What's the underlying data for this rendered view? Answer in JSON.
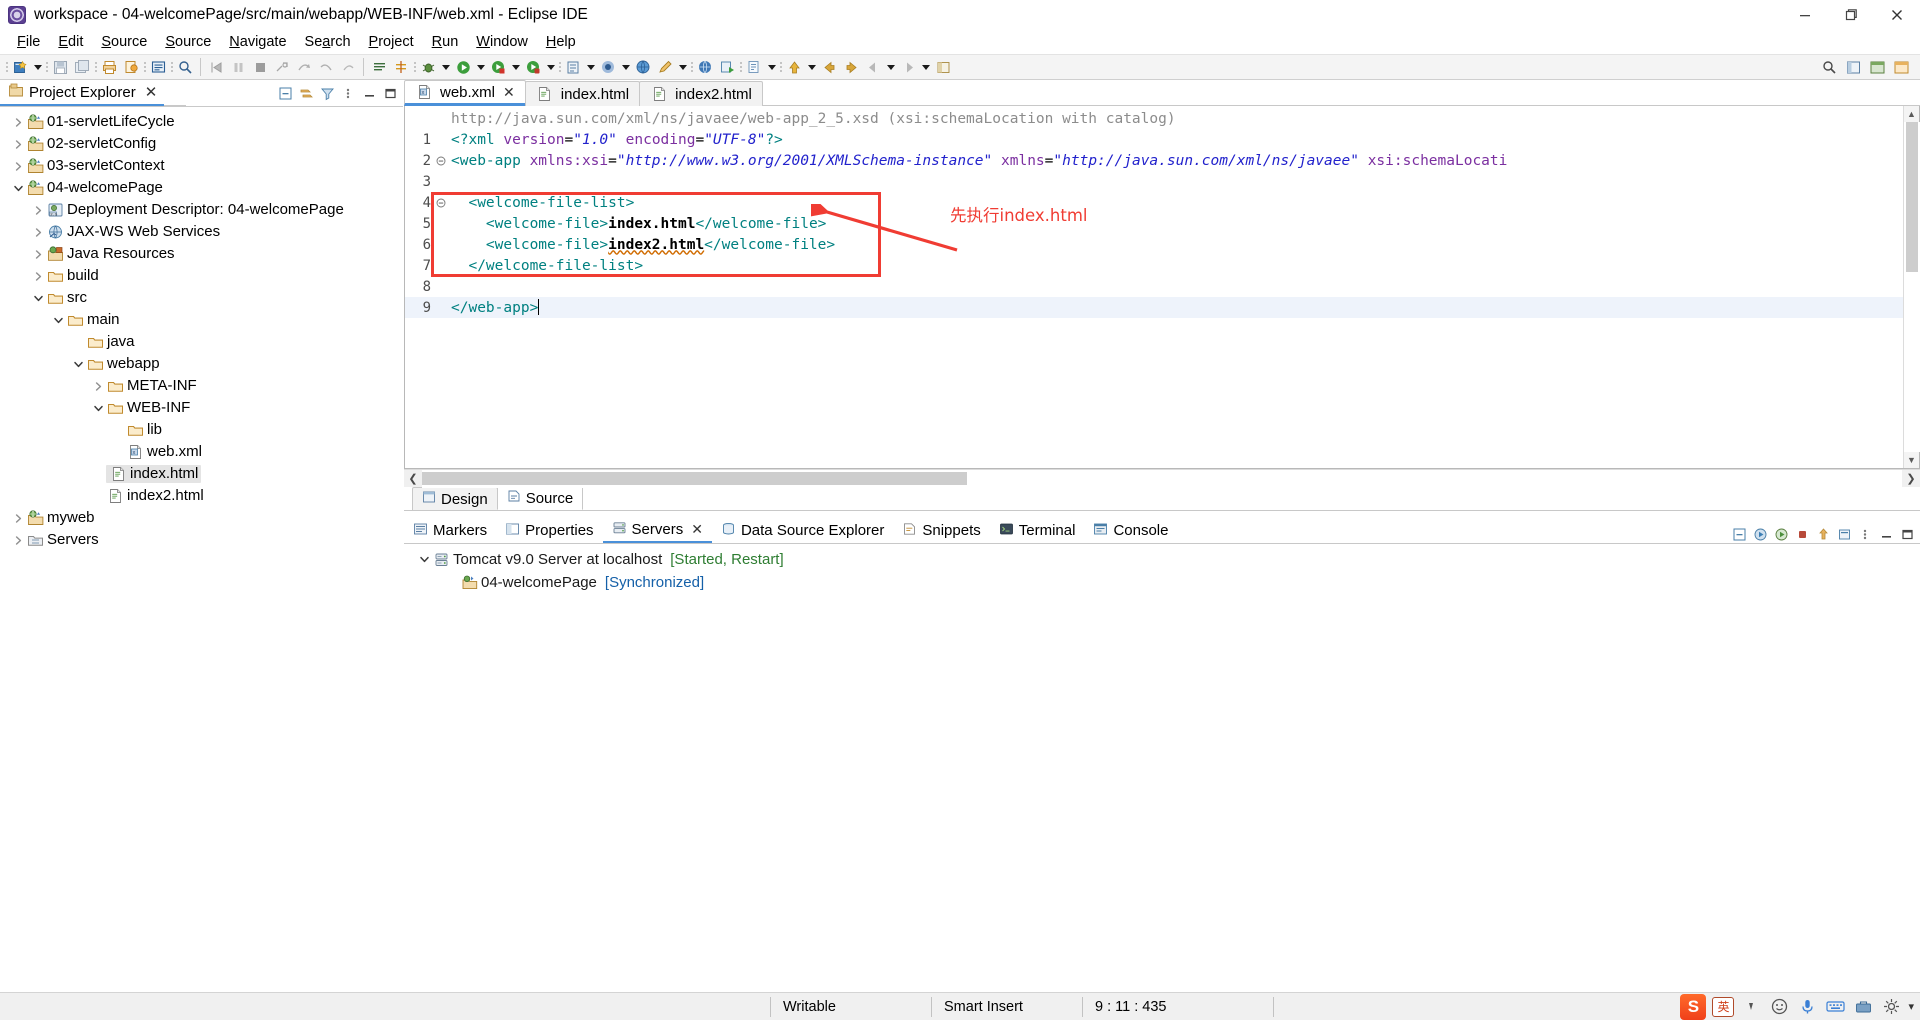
{
  "window": {
    "title": "workspace - 04-welcomePage/src/main/webapp/WEB-INF/web.xml - Eclipse IDE",
    "minimize_label": "Minimize",
    "maximize_label": "Restore",
    "close_label": "Close"
  },
  "menubar": {
    "items": [
      {
        "label": "File",
        "mnemonic": "F"
      },
      {
        "label": "Edit",
        "mnemonic": "E"
      },
      {
        "label": "Source",
        "mnemonic": "S"
      },
      {
        "label": "Source",
        "mnemonic": "S"
      },
      {
        "label": "Navigate",
        "mnemonic": "N"
      },
      {
        "label": "Search",
        "mnemonic": "a"
      },
      {
        "label": "Project",
        "mnemonic": "P"
      },
      {
        "label": "Run",
        "mnemonic": "R"
      },
      {
        "label": "Window",
        "mnemonic": "W"
      },
      {
        "label": "Help",
        "mnemonic": "H"
      }
    ]
  },
  "toolbar": {
    "icons": [
      "new-wizard-icon",
      "save-icon",
      "save-all-icon",
      "print-icon",
      "build-icon",
      "new-editor-icon",
      "quick-access-icon",
      "step-into-icon",
      "pause-icon",
      "terminate-icon",
      "disconnect-icon",
      "step-over-icon",
      "step-return-icon",
      "resume-icon",
      "toggle-breakpoint-icon",
      "skip-breakpoints-icon",
      "debug-icon",
      "run-icon",
      "run-external-icon",
      "run-server-icon",
      "coverage-icon",
      "open-type-icon",
      "search-icon",
      "browser-icon",
      "edit-icon",
      "globe-icon",
      "java-perspective-icon",
      "validate-icon",
      "back-icon",
      "forward-icon",
      "previous-annotation-icon",
      "next-annotation-icon",
      "last-edit-icon",
      "open-perspective-icon"
    ],
    "right_icons": [
      "search-icon",
      "open-perspective-icon",
      "java-ee-perspective-icon",
      "web-perspective-icon"
    ]
  },
  "project_explorer": {
    "tab_label": "Project Explorer",
    "tools": [
      "collapse-all-icon",
      "link-with-editor-icon",
      "view-menu-icon",
      "view-filter-icon",
      "minimize-icon",
      "maximize-icon"
    ],
    "tree": [
      {
        "label": "01-servletLifeCycle",
        "indent": 0,
        "arrow": "collapsed",
        "icon": "web-project-icon",
        "selected": false
      },
      {
        "label": "02-servletConfig",
        "indent": 0,
        "arrow": "collapsed",
        "icon": "web-project-icon",
        "selected": false
      },
      {
        "label": "03-servletContext",
        "indent": 0,
        "arrow": "collapsed",
        "icon": "web-project-icon",
        "selected": false
      },
      {
        "label": "04-welcomePage",
        "indent": 0,
        "arrow": "expanded",
        "icon": "web-project-icon",
        "selected": false
      },
      {
        "label": "Deployment Descriptor: 04-welcomePage",
        "indent": 1,
        "arrow": "collapsed",
        "icon": "deployment-descriptor-icon",
        "selected": false
      },
      {
        "label": "JAX-WS Web Services",
        "indent": 1,
        "arrow": "collapsed",
        "icon": "jaxws-icon",
        "selected": false
      },
      {
        "label": "Java Resources",
        "indent": 1,
        "arrow": "collapsed",
        "icon": "java-resources-icon",
        "selected": false
      },
      {
        "label": "build",
        "indent": 1,
        "arrow": "collapsed",
        "icon": "folder-icon",
        "selected": false
      },
      {
        "label": "src",
        "indent": 1,
        "arrow": "expanded",
        "icon": "folder-icon",
        "selected": false
      },
      {
        "label": "main",
        "indent": 2,
        "arrow": "expanded",
        "icon": "folder-icon",
        "selected": false
      },
      {
        "label": "java",
        "indent": 3,
        "arrow": "none",
        "icon": "folder-icon",
        "selected": false
      },
      {
        "label": "webapp",
        "indent": 3,
        "arrow": "expanded",
        "icon": "folder-icon",
        "selected": false
      },
      {
        "label": "META-INF",
        "indent": 4,
        "arrow": "collapsed",
        "icon": "folder-icon",
        "selected": false
      },
      {
        "label": "WEB-INF",
        "indent": 4,
        "arrow": "expanded",
        "icon": "folder-icon",
        "selected": false
      },
      {
        "label": "lib",
        "indent": 5,
        "arrow": "none",
        "icon": "folder-icon",
        "selected": false
      },
      {
        "label": "web.xml",
        "indent": 5,
        "arrow": "none",
        "icon": "xml-file-icon",
        "selected": false
      },
      {
        "label": "index.html",
        "indent": 4,
        "arrow": "none",
        "icon": "html-file-icon",
        "selected": true
      },
      {
        "label": "index2.html",
        "indent": 4,
        "arrow": "none",
        "icon": "html-file-icon",
        "selected": false
      },
      {
        "label": "myweb",
        "indent": 0,
        "arrow": "collapsed",
        "icon": "web-project-icon",
        "selected": false
      },
      {
        "label": "Servers",
        "indent": 0,
        "arrow": "collapsed",
        "icon": "servers-folder-icon",
        "selected": false
      }
    ]
  },
  "editor": {
    "tabs": [
      {
        "label": "web.xml",
        "icon": "xml-file-icon",
        "active": true,
        "closable": true
      },
      {
        "label": "index.html",
        "icon": "html-file-icon",
        "active": false,
        "closable": false
      },
      {
        "label": "index2.html",
        "icon": "html-file-icon",
        "active": false,
        "closable": false
      }
    ],
    "hover_hint": "http://java.sun.com/xml/ns/javaee/web-app_2_5.xsd (xsi:schemaLocation with catalog)",
    "lines": [
      {
        "no": "1",
        "fold": "",
        "segments": [
          {
            "t": "<?xml ",
            "c": "s-pi"
          },
          {
            "t": "version",
            "c": "s-attr"
          },
          {
            "t": "=",
            "c": "s-eq"
          },
          {
            "t": "\"1.0\"",
            "c": "s-val"
          },
          {
            "t": " ",
            "c": "s-eq"
          },
          {
            "t": "encoding",
            "c": "s-attr"
          },
          {
            "t": "=",
            "c": "s-eq"
          },
          {
            "t": "\"UTF-8\"",
            "c": "s-val"
          },
          {
            "t": "?>",
            "c": "s-pi"
          }
        ]
      },
      {
        "no": "2",
        "fold": "minus",
        "segments": [
          {
            "t": "<web-app ",
            "c": "s-tag"
          },
          {
            "t": "xmlns:xsi",
            "c": "s-attr"
          },
          {
            "t": "=",
            "c": "s-eq"
          },
          {
            "t": "\"http://www.w3.org/2001/XMLSchema-instance\"",
            "c": "s-val"
          },
          {
            "t": " ",
            "c": "s-eq"
          },
          {
            "t": "xmlns",
            "c": "s-attr"
          },
          {
            "t": "=",
            "c": "s-eq"
          },
          {
            "t": "\"http://java.sun.com/xml/ns/javaee\"",
            "c": "s-val"
          },
          {
            "t": " ",
            "c": "s-eq"
          },
          {
            "t": "xsi:schemaLocati",
            "c": "s-attr"
          }
        ]
      },
      {
        "no": "3",
        "fold": "",
        "segments": []
      },
      {
        "no": "4",
        "fold": "minus",
        "segments": [
          {
            "t": "  <welcome-file-list>",
            "c": "s-tag"
          }
        ]
      },
      {
        "no": "5",
        "fold": "",
        "segments": [
          {
            "t": "    <welcome-file>",
            "c": "s-tag"
          },
          {
            "t": "index.html",
            "c": "s-txt"
          },
          {
            "t": "</welcome-file>",
            "c": "s-tag"
          }
        ]
      },
      {
        "no": "6",
        "fold": "",
        "segments": [
          {
            "t": "    <welcome-file>",
            "c": "s-tag"
          },
          {
            "t": "index2.html",
            "c": "s-txt squiggle"
          },
          {
            "t": "</welcome-file>",
            "c": "s-tag"
          }
        ]
      },
      {
        "no": "7",
        "fold": "",
        "segments": [
          {
            "t": "  </welcome-file-list>",
            "c": "s-tag"
          }
        ]
      },
      {
        "no": "8",
        "fold": "",
        "segments": []
      },
      {
        "no": "9",
        "fold": "",
        "highlight": true,
        "caret": true,
        "segments": [
          {
            "t": "</web-app>",
            "c": "s-tag"
          }
        ]
      }
    ],
    "annotation": {
      "text": "先执行index.html",
      "color": "#f03c33",
      "arrow": "left-arrow",
      "box_color": "#f03c33"
    },
    "design_source_tabs": [
      {
        "label": "Design",
        "icon": "design-icon",
        "active": false
      },
      {
        "label": "Source",
        "icon": "source-icon",
        "active": true
      }
    ]
  },
  "bottom_panel": {
    "tabs": [
      {
        "label": "Markers",
        "icon": "markers-icon",
        "active": false,
        "closable": false
      },
      {
        "label": "Properties",
        "icon": "properties-icon",
        "active": false,
        "closable": false
      },
      {
        "label": "Servers",
        "icon": "servers-icon",
        "active": true,
        "closable": true
      },
      {
        "label": "Data Source Explorer",
        "icon": "data-source-icon",
        "active": false,
        "closable": false
      },
      {
        "label": "Snippets",
        "icon": "snippets-icon",
        "active": false,
        "closable": false
      },
      {
        "label": "Terminal",
        "icon": "terminal-icon",
        "active": false,
        "closable": false
      },
      {
        "label": "Console",
        "icon": "console-icon",
        "active": false,
        "closable": false
      }
    ],
    "tools": [
      "start-icon",
      "debug-icon",
      "stop-icon",
      "publish-icon",
      "new-server-icon",
      "view-menu-icon",
      "minimize-icon",
      "maximize-icon"
    ],
    "rows": [
      {
        "indent": 0,
        "arrow": "expanded",
        "icon": "server-icon",
        "label": "Tomcat v9.0 Server at localhost",
        "status": "[Started, Restart]",
        "status_color": "#2e7d32"
      },
      {
        "indent": 1,
        "arrow": "none",
        "icon": "deployed-module-icon",
        "label": "04-welcomePage",
        "status": "[Synchronized]",
        "status_color": "#1560a8"
      }
    ]
  },
  "statusbar": {
    "writable": "Writable",
    "insert_mode": "Smart Insert",
    "position": "9 : 11 : 435",
    "tray": {
      "sogou_label": "S",
      "lang_label": "英",
      "icons": [
        "sogou-icon",
        "language-icon",
        "comma-icon",
        "emoji-icon",
        "mic-icon",
        "keyboard-icon",
        "toolbox-icon",
        "settings-icon",
        "menu-icon"
      ]
    }
  }
}
